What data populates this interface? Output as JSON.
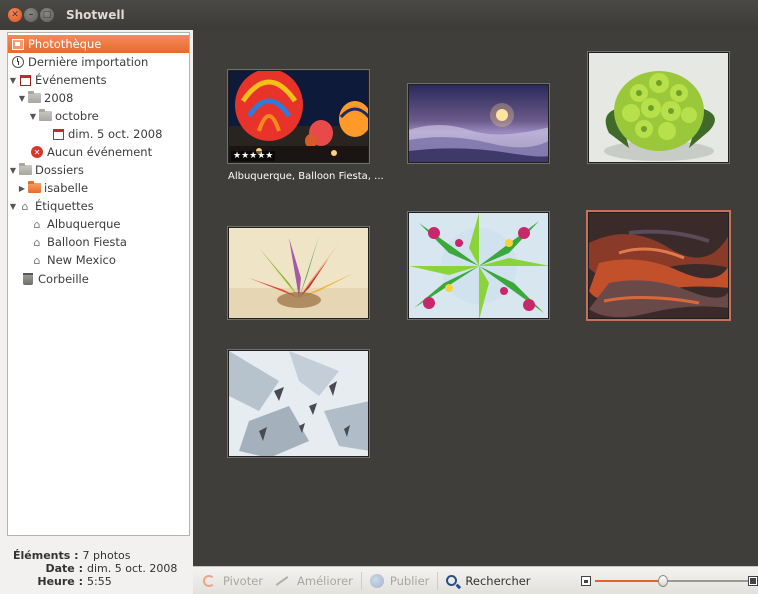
{
  "window": {
    "title": "Shotwell",
    "controls": {
      "close": "close-icon",
      "minimize": "minimize-icon",
      "maximize": "maximize-icon"
    }
  },
  "sidebar": {
    "library": "Photothèque",
    "last_import": "Dernière importation",
    "events": "Événements",
    "year": "2008",
    "month": "octobre",
    "event_day": "dim. 5 oct. 2008",
    "no_event": "Aucun événement",
    "folders": "Dossiers",
    "folder_isabelle": "isabelle",
    "tags": "Étiquettes",
    "tag_items": [
      "Albuquerque",
      "Balloon Fiesta",
      "New Mexico"
    ],
    "trash": "Corbeille"
  },
  "info": {
    "elements_key": "Éléments :",
    "elements_val": "7 photos",
    "date_key": "Date :",
    "date_val": "dim. 5 oct. 2008",
    "time_key": "Heure :",
    "time_val": "5:55"
  },
  "photos": [
    {
      "caption": "Albuquerque, Balloon Fiesta, ...",
      "rating": "★★★★★",
      "subject": "hot air balloons at night"
    },
    {
      "caption": "",
      "subject": "sun over clouds"
    },
    {
      "caption": "",
      "subject": "romanesco broccoli"
    },
    {
      "caption": "",
      "subject": "abstract flowers"
    },
    {
      "caption": "",
      "subject": "fractal leaves"
    },
    {
      "caption": "",
      "subject": "red rock texture"
    },
    {
      "caption": "",
      "subject": "snowy mountains aerial"
    }
  ],
  "toolbar": {
    "rotate": "Pivoter",
    "enhance": "Améliorer",
    "publish": "Publier",
    "search": "Rechercher",
    "zoom_level": 0.45
  },
  "colors": {
    "accent": "#e8692f",
    "content_bg": "#3f3e3b",
    "titlebar_bg": "#3c3b37"
  }
}
